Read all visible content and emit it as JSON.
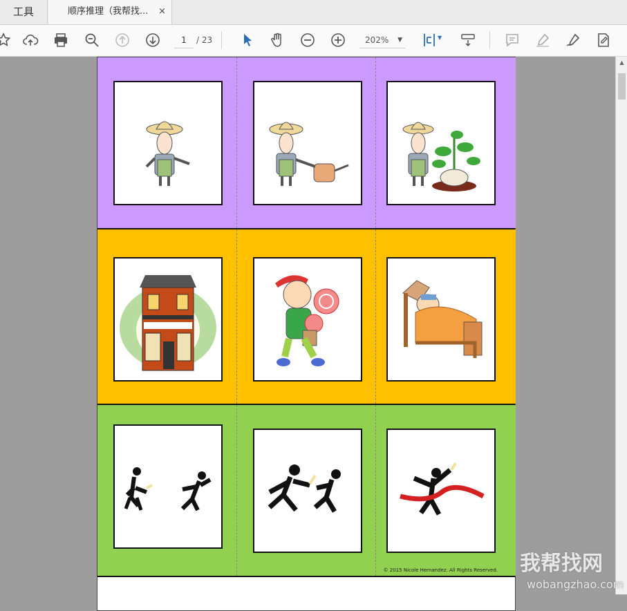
{
  "tabs": {
    "tools_label": "工具",
    "document_title": "顺序推理（我帮找...",
    "close_symbol": "×"
  },
  "toolbar": {
    "page_current": "1",
    "page_total": "/ 23",
    "zoom_value": "202%"
  },
  "icons": [
    "bookmark-star-icon",
    "upload-cloud-icon",
    "print-icon",
    "search-zoom-icon",
    "previous-page-icon",
    "next-page-icon",
    "select-cursor-icon",
    "hand-tool-icon",
    "zoom-out-icon",
    "zoom-in-icon",
    "fit-page-icon",
    "scroll-mode-icon",
    "comment-icon",
    "highlight-icon",
    "sign-icon",
    "edit-pdf-icon"
  ],
  "document": {
    "rows": [
      {
        "color": "#cc99ff",
        "cards": [
          "farmer-standing",
          "farmer-watering",
          "farmer-plant-grown"
        ]
      },
      {
        "color": "#ffc000",
        "cards": [
          "candy-shop",
          "boy-with-lollipops",
          "sick-boy-in-bed"
        ]
      },
      {
        "color": "#92d050",
        "cards": [
          "runners-relay-start",
          "runners-passing-baton",
          "runner-finish-line"
        ]
      }
    ],
    "copyright": "© 2015 Nicole Hernandez. All Rights Reserved."
  },
  "watermark": {
    "logo_text": "我帮找网",
    "site_text": "wobangzhao.com"
  }
}
